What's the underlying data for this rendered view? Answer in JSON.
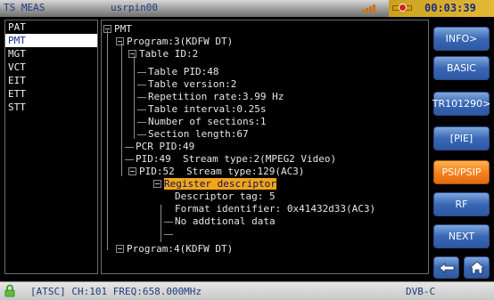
{
  "titlebar": {
    "app_title": "TS MEAS",
    "file_name": "usrpin00",
    "time": "00:03:39",
    "signal_icon": "signal-strength-icon",
    "record_icon": "record-icon"
  },
  "tables": {
    "items": [
      "PAT",
      "PMT",
      "MGT",
      "VCT",
      "EIT",
      "ETT",
      "STT"
    ],
    "selected": "PMT"
  },
  "tree": {
    "lines": [
      "PMT",
      "Program:3(KDFW DT)",
      "Table ID:2",
      "Table PID:48",
      "Table version:2",
      "Repetition rate:3.99 Hz",
      "Table interval:0.25s",
      "Number of sections:1",
      "Section length:67",
      "PCR PID:49",
      "PID:49  Stream type:2(MPEG2 Video)",
      "PID:52  Stream type:129(AC3)",
      "Register descriptor",
      "Descriptor tag: 5",
      "Format identifier: 0x41432d33(AC3)",
      "No addtional data",
      "Program:4(KDFW DT)"
    ],
    "selected_line": "Register descriptor"
  },
  "buttons": {
    "info": "INFO>",
    "basic": "BASIC",
    "tr101290": "TR101290>",
    "pie": "[PIE]",
    "psi_psip": "PSI/PSIP",
    "rf": "RF",
    "next": "NEXT",
    "back_icon": "back-arrow-icon",
    "home_icon": "home-icon"
  },
  "status": {
    "info": "[ATSC] CH:101 FREQ:658.000MHz",
    "mode": "DVB-C",
    "lock_icon": "lock-icon"
  },
  "colors": {
    "button_blue": "#3a68b4",
    "button_active_orange": "#f5801c",
    "selection_highlight": "#f3a51a",
    "title_text": "#1e3c7a"
  }
}
